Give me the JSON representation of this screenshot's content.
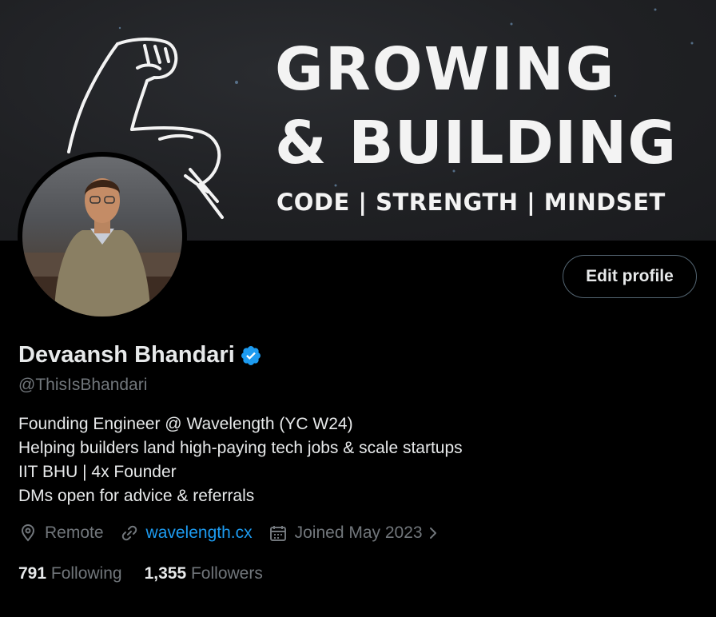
{
  "banner": {
    "headline_line1": "GROWING",
    "headline_line2": "& BUILDING",
    "tagline": "CODE  |  STRENGTH  |  MINDSET"
  },
  "profile": {
    "name": "Devaansh Bhandari",
    "handle": "@ThisIsBhandari",
    "verified": true,
    "bio": [
      "Founding Engineer @ Wavelength (YC W24)",
      "Helping builders land high-paying tech jobs & scale startups",
      "IIT BHU | 4x Founder",
      "DMs open for advice & referrals"
    ],
    "location": "Remote",
    "website": "wavelength.cx",
    "joined": "Joined May 2023",
    "following_count": "791",
    "following_label": "Following",
    "followers_count": "1,355",
    "followers_label": "Followers"
  },
  "actions": {
    "edit_profile": "Edit profile"
  },
  "colors": {
    "background": "#000000",
    "primary_text": "#e7e9ea",
    "secondary_text": "#71767b",
    "link": "#1d9bf0",
    "verified_badge": "#1d9bf0",
    "button_border": "#536471"
  },
  "icons": [
    "location-pin-icon",
    "link-icon",
    "calendar-icon",
    "chevron-right-icon",
    "verified-badge-icon",
    "flexed-arm-icon"
  ]
}
